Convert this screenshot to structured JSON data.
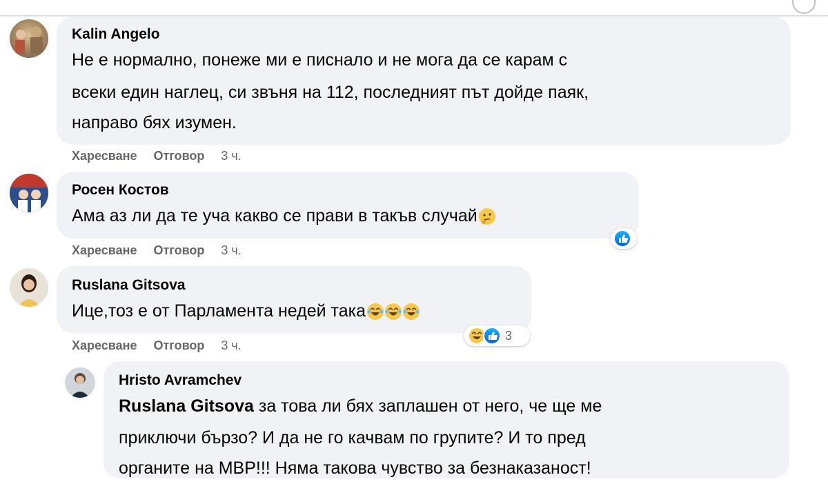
{
  "colors": {
    "bubble": "#f0f2f5",
    "secondary_text": "#65676b",
    "like_blue": "#1877f2",
    "emoji_yellow": "#f7c948"
  },
  "comments": [
    {
      "author": "Kalin Angelo",
      "lines": [
        "Не е нормално, понеже ми е писнало и не мога да се карам с",
        "всеки един наглец, си звъня на 112, последният път дойде паяк,",
        "направо бях изумен."
      ],
      "like_label": "Харесване",
      "reply_label": "Отговор",
      "time": "3 ч."
    },
    {
      "author": "Росен Костов",
      "lines": [
        "Ама аз ли да те уча какво се прави в такъв случай"
      ],
      "trailing_emoji": "thinking-face",
      "reactions": [
        "like"
      ],
      "like_label": "Харесване",
      "reply_label": "Отговор",
      "time": "3 ч."
    },
    {
      "author": "Ruslana Gitsova",
      "lines": [
        "Ице,тоз е от Парламента недей така"
      ],
      "trailing_emoji": "laughing-face x3",
      "reactions": [
        "haha",
        "like"
      ],
      "reaction_count": "3",
      "like_label": "Харесване",
      "reply_label": "Отговор",
      "time": "3 ч."
    },
    {
      "author": "Hristo Avramchev",
      "mention": "Ruslana Gitsova",
      "lines": [
        " за това ли бях заплашен от него, че ще ме",
        "приключи бързо? И да не го качвам по групите? И то пред",
        "органите на МВР!!! Няма такова чувство за безнаказаност!"
      ]
    }
  ]
}
